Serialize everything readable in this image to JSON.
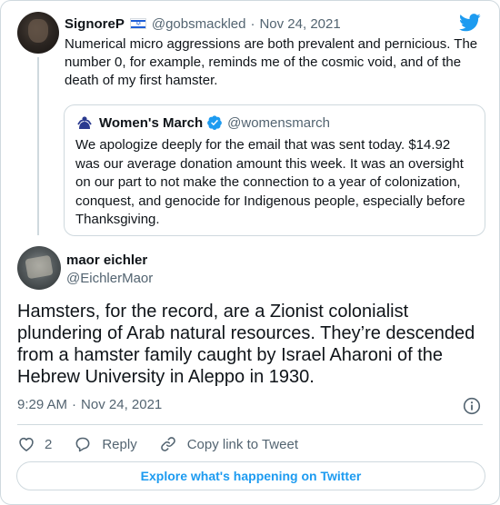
{
  "parent_tweet": {
    "author_name": "SignoreP",
    "flag_icon": "israel-flag-icon",
    "handle": "@gobsmackled",
    "dot": "·",
    "date": "Nov 24, 2021",
    "text": "Numerical micro aggressions are both prevalent and pernicious. The number 0, for example, reminds me of the cosmic void, and of the death of my first hamster."
  },
  "quoted_tweet": {
    "author_name": "Women's March",
    "handle": "@womensmarch",
    "verified_icon": "verified-badge-icon",
    "text": "We apologize deeply for the email that was sent today. $14.92 was our average donation amount this week. It was an oversight on our part to not make the connection to a year of colonization, conquest, and genocide for Indigenous people, especially before Thanksgiving."
  },
  "main_tweet": {
    "author_name": "maor eichler",
    "handle": "@EichlerMaor",
    "text": "Hamsters, for the record, are a Zionist colonialist plundering of Arab natural resources. They’re descended from a hamster family caught by Israel Aharoni of the Hebrew University in Aleppo in 1930.",
    "time": "9:29 AM",
    "dot": "·",
    "date": "Nov 24, 2021"
  },
  "actions": {
    "like_count": "2",
    "reply_label": "Reply",
    "copy_link_label": "Copy link to Tweet"
  },
  "explore_label": "Explore what's happening on Twitter",
  "colors": {
    "twitter_blue": "#1d9bf0",
    "text_primary": "#0f1419",
    "text_secondary": "#536471",
    "border": "#cfd9de"
  }
}
